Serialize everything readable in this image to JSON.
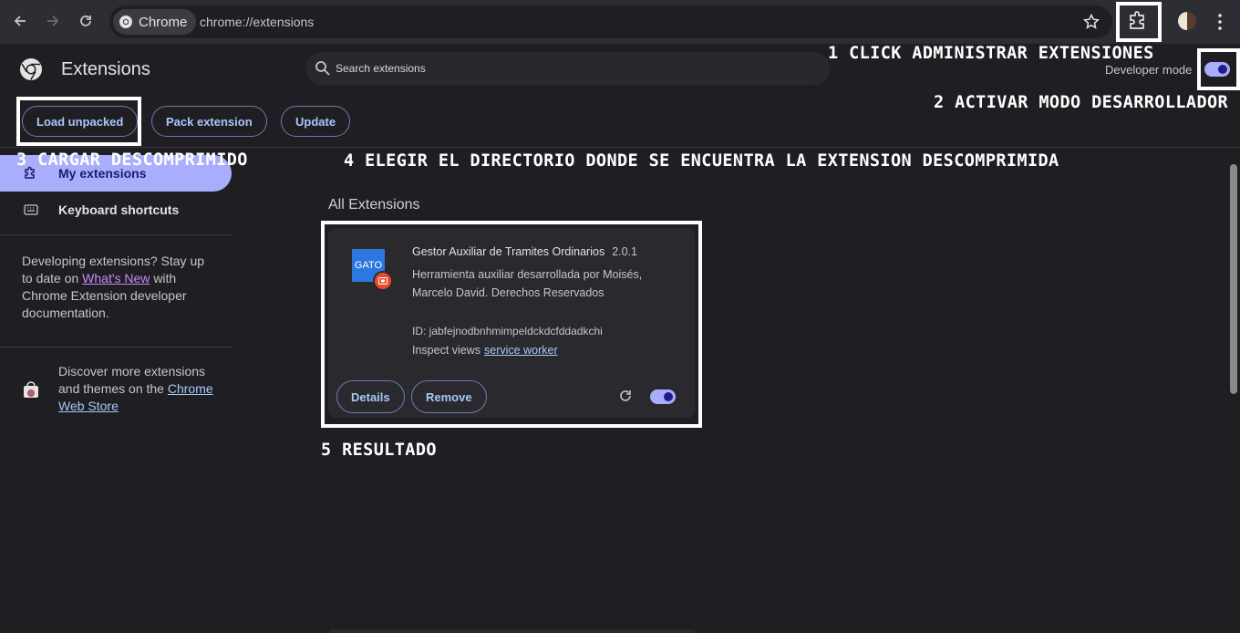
{
  "browser": {
    "chip_label": "Chrome",
    "url": "chrome://extensions"
  },
  "header": {
    "title": "Extensions",
    "search_placeholder": "Search extensions",
    "developer_mode_label": "Developer mode",
    "developer_mode_on": true,
    "buttons": {
      "load_unpacked": "Load unpacked",
      "pack_extension": "Pack extension",
      "update": "Update"
    }
  },
  "sidebar": {
    "items": [
      {
        "label": "My extensions",
        "icon": "puzzle-icon",
        "active": true
      },
      {
        "label": "Keyboard shortcuts",
        "icon": "keyboard-icon",
        "active": false
      }
    ],
    "dev_info": {
      "prefix": "Developing extensions? Stay up to date on",
      "link": "What's New",
      "suffix": "with Chrome Extension developer documentation."
    },
    "store_info": {
      "prefix": "Discover more extensions and themes on the",
      "link": "Chrome Web Store"
    }
  },
  "main": {
    "section_title": "All Extensions",
    "extension": {
      "icon_text": "GATO",
      "name": "Gestor Auxiliar de Tramites Ordinarios",
      "version": "2.0.1",
      "description": "Herramienta auxiliar desarrollada por Moisés, Marcelo David. Derechos Reservados",
      "id_text": "ID: jabfejnodbnhmimpeldckdcfddadkchi",
      "inspect_label": "Inspect views",
      "inspect_link": "service worker",
      "details_label": "Details",
      "remove_label": "Remove",
      "enabled": true
    }
  },
  "annotations": {
    "step1": "1 CLICK ADMINISTRAR EXTENSIONES",
    "step2": "2 ACTIVAR MODO DESARROLLADOR",
    "step3": "3 CARGAR DESCOMPRIMIDO",
    "step4": "4 ELEGIR EL DIRECTORIO DONDE SE ENCUENTRA LA EXTENSION DESCOMPRIMIDA",
    "step5": "5 RESULTADO"
  },
  "colors": {
    "background": "#1f1f23",
    "accent": "#a8aefc",
    "link": "#a8c7fa",
    "annotation": "#ffffff"
  }
}
